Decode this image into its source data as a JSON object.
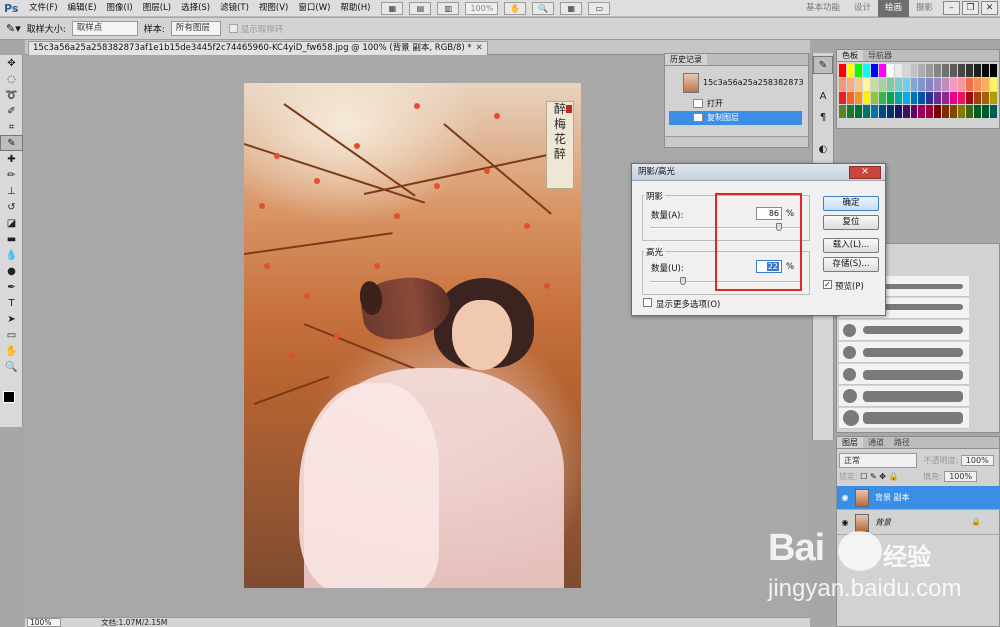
{
  "app": {
    "logo": "Ps"
  },
  "menubar": {
    "items": [
      "文件(F)",
      "编辑(E)",
      "图像(I)",
      "图层(L)",
      "选择(S)",
      "滤镜(T)",
      "视图(V)",
      "窗口(W)",
      "帮助(H)"
    ],
    "zoom_select": "100%",
    "workspaces": [
      "基本功能",
      "设计",
      "绘画",
      "摄影"
    ],
    "active_workspace": "绘画"
  },
  "options": {
    "sample_size_label": "取样大小:",
    "sample_size_value": "取样点",
    "sample_label": "样本:",
    "sample_value": "所有图层",
    "show_ring_label": "显示取样环"
  },
  "document": {
    "tab_title": "15c3a56a25a258382873af1e1b15de3445f2c74465960-KC4yiD_fw658.jpg @ 100% (背景 副本, RGB/8) *",
    "seal_text": [
      "醉",
      "梅",
      "花",
      "醉"
    ],
    "zoom": "100%",
    "doc_info": "文档:1.07M/2.15M"
  },
  "history": {
    "tabs": [
      "历史记录"
    ],
    "snapshot_label": "15c3a56a25a258382873a...",
    "entries": [
      "打开",
      "复制图层"
    ],
    "selected": "复制图层"
  },
  "color_panel": {
    "tabs": [
      "色板",
      "导航器"
    ]
  },
  "layers": {
    "tabs": [
      "图层",
      "通道",
      "路径"
    ],
    "blend_mode": "正常",
    "opacity_label": "不透明度:",
    "opacity": "100%",
    "lock_label": "锁定:",
    "fill_label": "填充:",
    "fill": "100%",
    "items": [
      {
        "name": "背景 副本",
        "selected": true
      },
      {
        "name": "背景",
        "selected": false
      }
    ]
  },
  "dialog": {
    "title": "阴影/高光",
    "shadows": {
      "legend": "阴影",
      "amount_label": "数量(A):",
      "amount": 86,
      "unit": "%"
    },
    "highlights": {
      "legend": "高光",
      "amount_label": "数量(U):",
      "amount": 22,
      "unit": "%"
    },
    "more_options_label": "显示更多选项(O)",
    "buttons": {
      "ok": "确定",
      "reset": "复位",
      "load": "载入(L)...",
      "save": "存储(S)..."
    },
    "preview_label": "预览(P)",
    "preview_checked": true
  },
  "watermark": {
    "brand": "Bai",
    "brand_cn": "经验",
    "url": "jingyan.baidu.com"
  },
  "colors": {
    "accent": "#3a8ee6",
    "highlight_box": "#e0262a"
  }
}
